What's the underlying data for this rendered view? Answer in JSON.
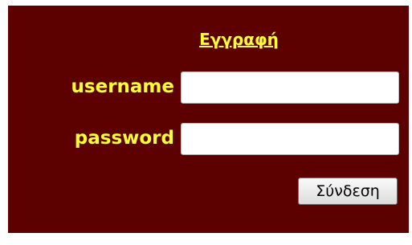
{
  "form": {
    "register_link": "Εγγραφή",
    "username_label": "username",
    "username_value": "",
    "password_label": "password",
    "password_value": "",
    "login_button": "Σύνδεση"
  },
  "colors": {
    "panel_background": "#5c0000",
    "label_text": "#ffff33"
  }
}
